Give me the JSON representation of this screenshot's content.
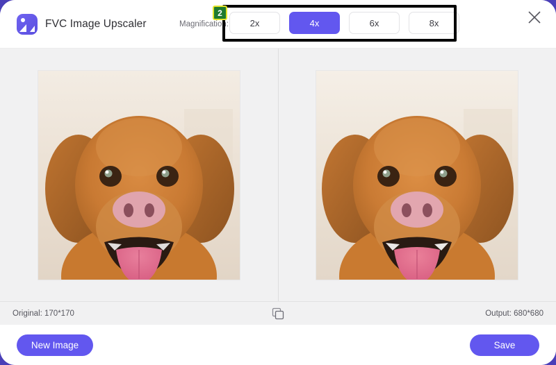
{
  "window": {
    "title": "FVC Image Upscaler",
    "logo_icon": "image-photo-icon",
    "close_icon": "close-icon"
  },
  "header": {
    "magnification_label": "Magnification:",
    "step_badge": "2",
    "options": [
      {
        "label": "2x",
        "selected": false
      },
      {
        "label": "4x",
        "selected": true
      },
      {
        "label": "6x",
        "selected": false
      },
      {
        "label": "8x",
        "selected": false
      }
    ],
    "selected_option": "4x"
  },
  "preview": {
    "original_alt": "original-dog-photo",
    "output_alt": "upscaled-dog-photo"
  },
  "status": {
    "original": "Original: 170*170",
    "output": "Output: 680*680",
    "compare_icon": "duplicate-squares-icon"
  },
  "footer": {
    "new_image_label": "New Image",
    "save_label": "Save"
  },
  "colors": {
    "accent": "#6257ef",
    "badge_green": "#1f7a2e",
    "badge_border": "#e3e32a",
    "highlight": "#000000",
    "panel_bg": "#f1f1f2"
  }
}
